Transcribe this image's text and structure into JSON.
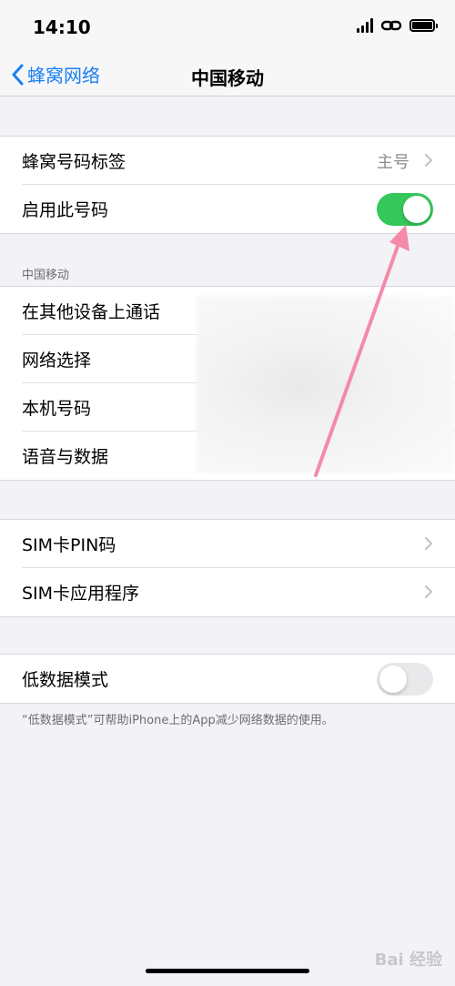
{
  "status_bar": {
    "time": "14:10"
  },
  "nav": {
    "back_label": "蜂窝网络",
    "title": "中国移动"
  },
  "group1": {
    "items": [
      {
        "label": "蜂窝号码标签",
        "detail": "主号"
      },
      {
        "label": "启用此号码",
        "toggle": "on"
      }
    ]
  },
  "group2": {
    "header": "中国移动",
    "items": [
      {
        "label": "在其他设备上通话"
      },
      {
        "label": "网络选择"
      },
      {
        "label": "本机号码"
      },
      {
        "label": "语音与数据"
      }
    ]
  },
  "group3": {
    "items": [
      {
        "label": "SIM卡PIN码"
      },
      {
        "label": "SIM卡应用程序"
      }
    ]
  },
  "group4": {
    "items": [
      {
        "label": "低数据模式",
        "toggle": "off"
      }
    ],
    "footer": "“低数据模式”可帮助iPhone上的App减少网络数据的使用。"
  },
  "watermark": "Bai 经验",
  "colors": {
    "accent": "#1a7ff3",
    "switch_on": "#34c759",
    "arrow": "#f48aa8"
  }
}
